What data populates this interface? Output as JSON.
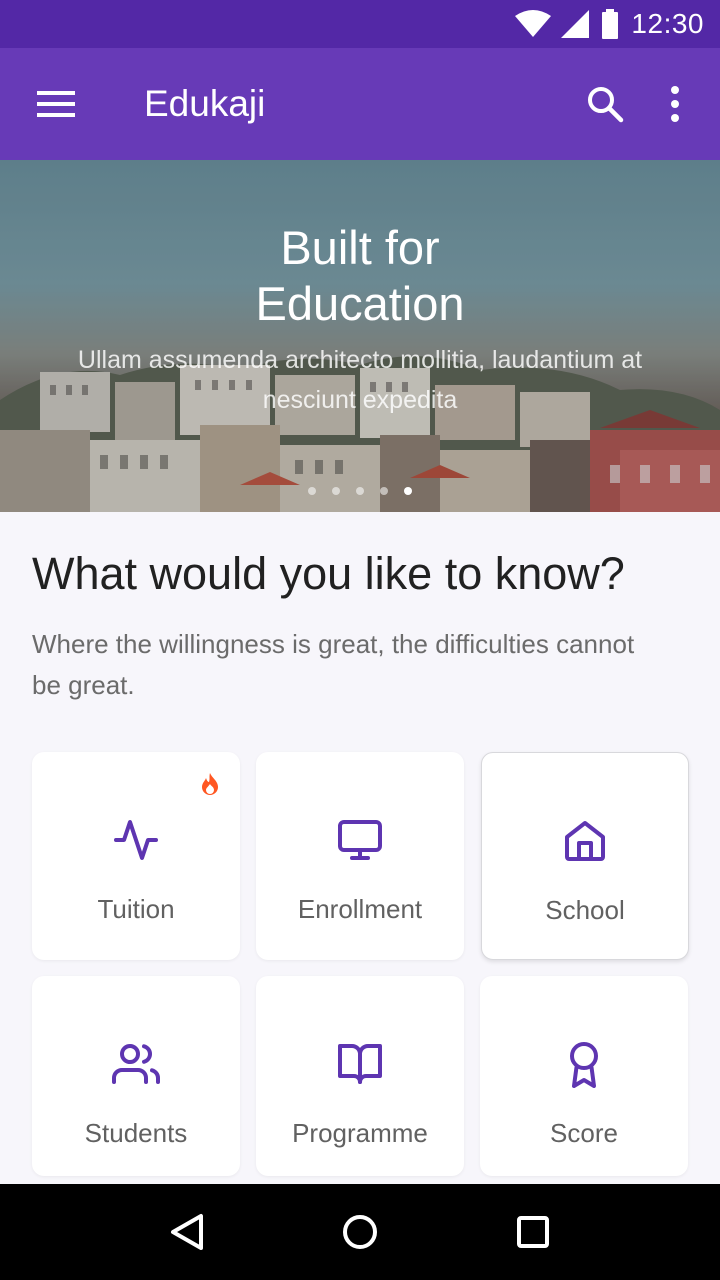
{
  "status_bar": {
    "time": "12:30"
  },
  "app_bar": {
    "title": "Edukaji"
  },
  "hero": {
    "title_line1": "Built for",
    "title_line2": "Education",
    "subtitle": "Ullam assumenda architecto mollitia, laudantium at nesciunt expedita",
    "slide_count": 5,
    "active_slide": 5
  },
  "section": {
    "title": "What would you like to know?",
    "subtitle": "Where the willingness is great, the difficulties cannot be great."
  },
  "categories": [
    {
      "label": "Tuition",
      "icon": "activity-icon",
      "badge": "fire-icon"
    },
    {
      "label": "Enrollment",
      "icon": "monitor-icon"
    },
    {
      "label": "School",
      "icon": "home-icon",
      "selected": true
    },
    {
      "label": "Students",
      "icon": "users-icon"
    },
    {
      "label": "Programme",
      "icon": "book-open-icon"
    },
    {
      "label": "Score",
      "icon": "award-icon"
    }
  ],
  "colors": {
    "primary": "#673ab7",
    "primary_dark": "#5328a6",
    "icon_accent": "#5e35b1",
    "badge": "#ff5722"
  }
}
